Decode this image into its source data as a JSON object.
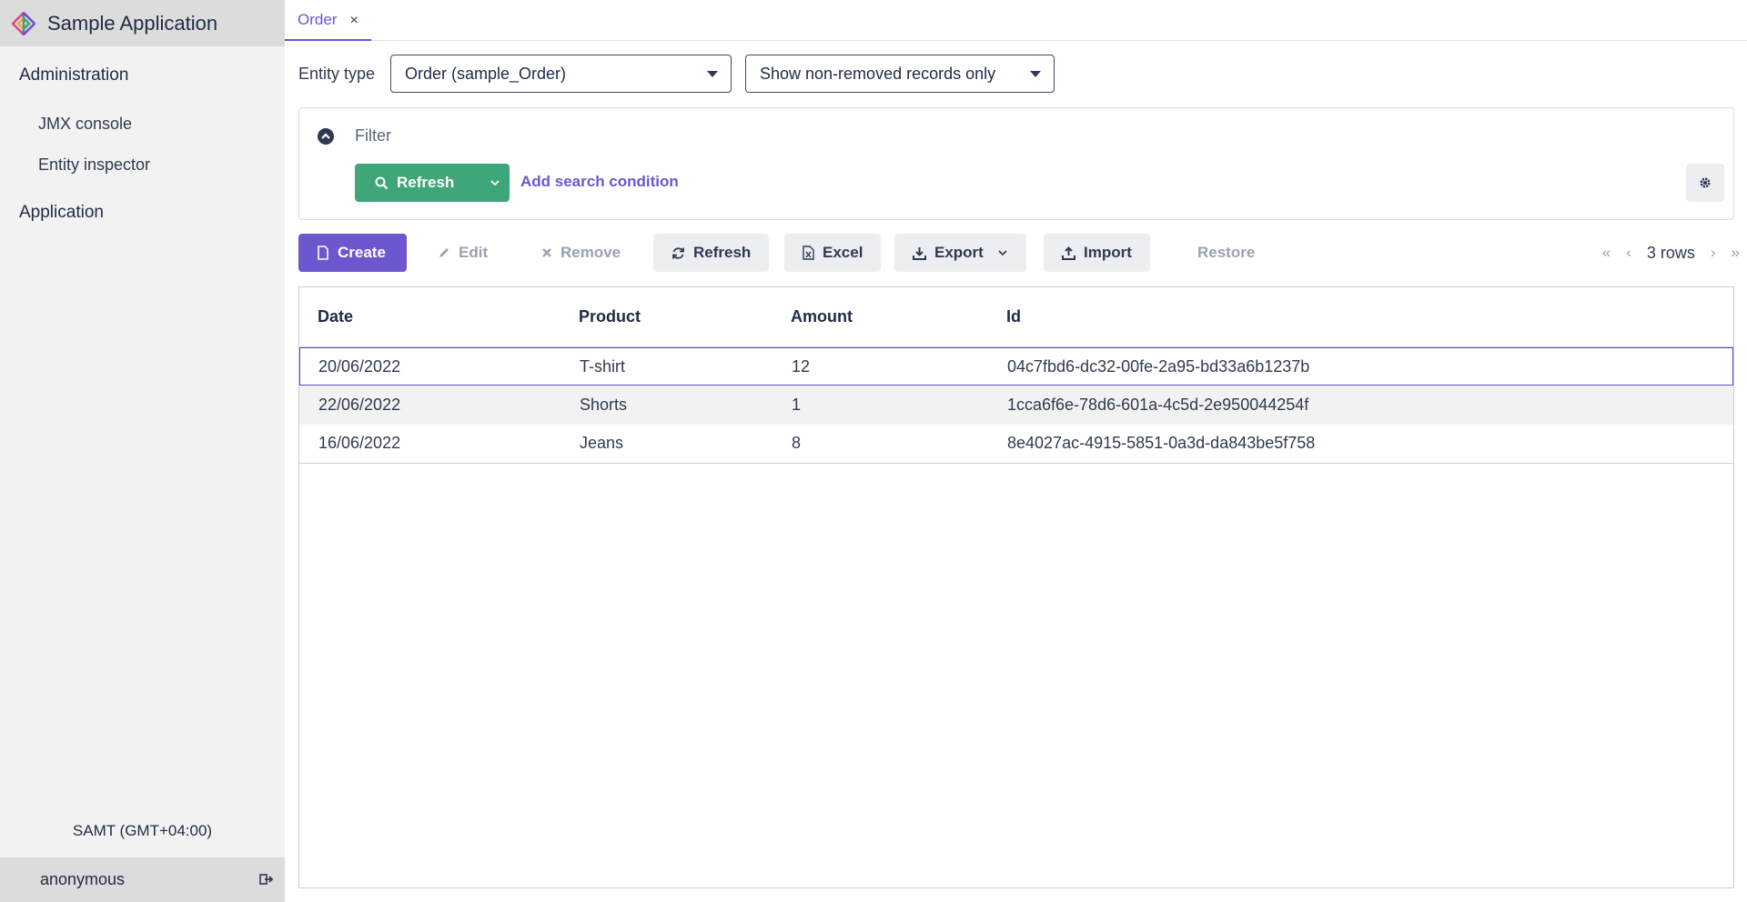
{
  "sidebar": {
    "app_title": "Sample Application",
    "groups": [
      {
        "label": "Administration",
        "items": [
          {
            "label": "JMX console"
          },
          {
            "label": "Entity inspector"
          }
        ]
      },
      {
        "label": "Application",
        "items": []
      }
    ],
    "timezone": "SAMT (GMT+04:00)",
    "user": "anonymous"
  },
  "tabs": [
    {
      "label": "Order",
      "close": "×"
    }
  ],
  "entity_type": {
    "label": "Entity type",
    "value": "Order (sample_Order)",
    "removed_filter": "Show non-removed records only"
  },
  "filter": {
    "label": "Filter",
    "refresh_label": "Refresh",
    "add_condition_label": "Add search condition"
  },
  "toolbar": {
    "create": "Create",
    "edit": "Edit",
    "remove": "Remove",
    "refresh": "Refresh",
    "excel": "Excel",
    "export": "Export",
    "import": "Import",
    "restore": "Restore"
  },
  "pager": {
    "rows_label": "3 rows",
    "first": "«",
    "prev": "‹",
    "next": "›",
    "last": "»"
  },
  "grid": {
    "columns": [
      "Date",
      "Product",
      "Amount",
      "Id"
    ],
    "rows": [
      [
        "20/06/2022",
        "T-shirt",
        "12",
        "04c7fbd6-dc32-00fe-2a95-bd33a6b1237b"
      ],
      [
        "22/06/2022",
        "Shorts",
        "1",
        "1cca6f6e-78d6-601a-4c5d-2e950044254f"
      ],
      [
        "16/06/2022",
        "Jeans",
        "8",
        "8e4027ac-4915-5851-0a3d-da843be5f758"
      ]
    ]
  },
  "colors": {
    "accent": "#6e56cf",
    "success": "#3fa67a",
    "sidebar_bg": "#f2f2f2"
  }
}
